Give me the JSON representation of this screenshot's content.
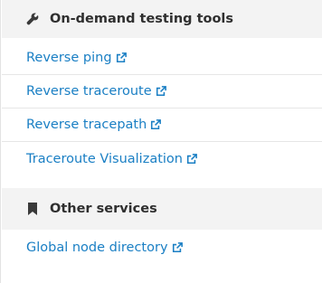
{
  "sections": [
    {
      "title": "On-demand testing tools",
      "icon": "wrench-icon",
      "links": [
        {
          "label": "Reverse ping"
        },
        {
          "label": "Reverse traceroute"
        },
        {
          "label": "Reverse tracepath"
        },
        {
          "label": "Traceroute Visualization"
        }
      ]
    },
    {
      "title": "Other services",
      "icon": "bookmark-icon",
      "links": [
        {
          "label": "Global node directory"
        }
      ]
    }
  ],
  "colors": {
    "link": "#1a7fc4",
    "header_bg": "#f3f3f3",
    "header_text": "#2f2f2f"
  }
}
